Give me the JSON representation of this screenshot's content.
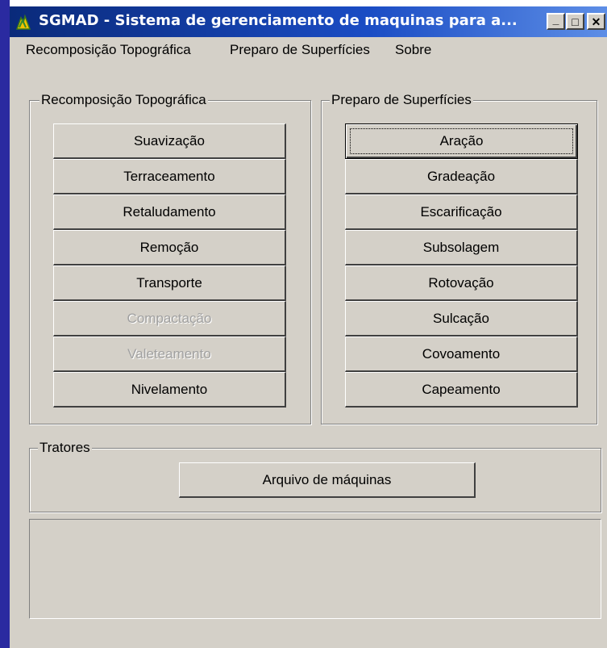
{
  "window": {
    "title": "SGMAD - Sistema de gerenciamento de maquinas  para a...",
    "colors": {
      "titlebar": "#0a2a7a",
      "face": "#d4d0c8",
      "disabled_text": "#a0a0a0"
    }
  },
  "titlebar_buttons": {
    "minimize": "_",
    "maximize": "□",
    "close": "✕"
  },
  "menu": {
    "items": [
      "Recomposição Topográfica",
      "Preparo de Superfícies",
      "Sobre"
    ]
  },
  "recomposicao": {
    "label": "Recomposição Topográfica",
    "buttons": [
      {
        "label": "Suavização",
        "enabled": true
      },
      {
        "label": "Terraceamento",
        "enabled": true
      },
      {
        "label": "Retaludamento",
        "enabled": true
      },
      {
        "label": "Remoção",
        "enabled": true
      },
      {
        "label": "Transporte",
        "enabled": true
      },
      {
        "label": "Compactação",
        "enabled": false
      },
      {
        "label": "Valeteamento",
        "enabled": false
      },
      {
        "label": "Nivelamento",
        "enabled": true
      }
    ]
  },
  "preparo": {
    "label": "Preparo  de Superfícies",
    "buttons": [
      {
        "label": "Aração",
        "focused": true
      },
      {
        "label": "Gradeação"
      },
      {
        "label": "Escarificação"
      },
      {
        "label": "Subsolagem"
      },
      {
        "label": "Rotovação"
      },
      {
        "label": "Sulcação"
      },
      {
        "label": "Covoamento"
      },
      {
        "label": "Capeamento"
      }
    ]
  },
  "tratores": {
    "label": "Tratores",
    "button_label": "Arquivo de máquinas"
  }
}
